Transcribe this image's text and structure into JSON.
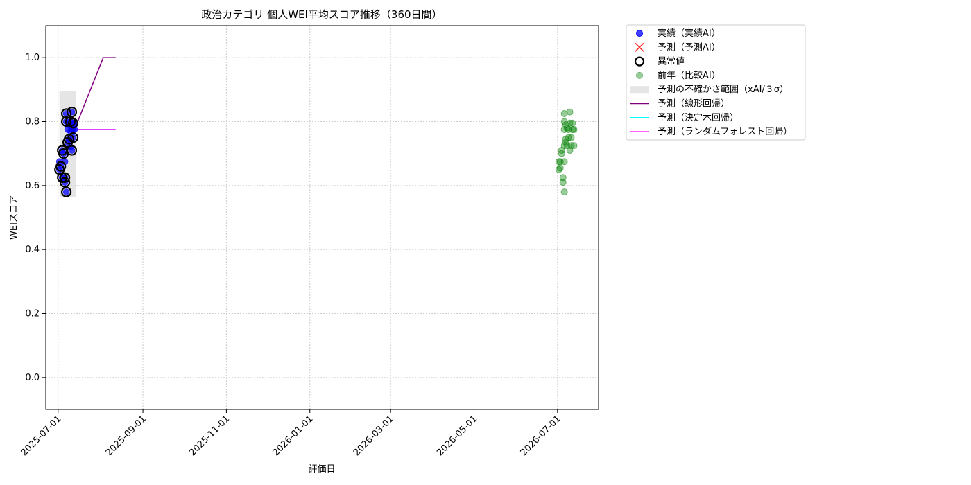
{
  "chart_data": {
    "type": "scatter",
    "title": "政治カテゴリ 個人WEI平均スコア推移（360日間）",
    "xlabel": "評価日",
    "ylabel": "WEIスコア",
    "xlim": [
      "2025-06-22",
      "2026-07-31"
    ],
    "ylim": [
      -0.1,
      1.1
    ],
    "grid": true,
    "legend_position": "outside-top-right",
    "x_ticks": [
      "2025-07-01",
      "2025-09-01",
      "2025-11-01",
      "2026-01-01",
      "2026-03-01",
      "2026-05-01",
      "2026-07-01"
    ],
    "y_ticks": [
      "0.0",
      "0.2",
      "0.4",
      "0.6",
      "0.8",
      "1.0"
    ],
    "colors": {
      "actual": "#0000ff",
      "predicted": "#ff0000",
      "anomaly_edge": "#000000",
      "previous_year": "#008000",
      "uncertainty": "#d3d3d3",
      "linear": "#800080",
      "tree": "#00ffff",
      "forest": "#ff00ff",
      "grid": "#cccccc"
    },
    "series": [
      {
        "name": "実績（実績AI）",
        "kind": "scatter",
        "points": [
          {
            "x": "2025-07-02",
            "y": 0.675
          },
          {
            "x": "2025-07-02",
            "y": 0.65
          },
          {
            "x": "2025-07-03",
            "y": 0.66
          },
          {
            "x": "2025-07-04",
            "y": 0.71
          },
          {
            "x": "2025-07-04",
            "y": 0.625
          },
          {
            "x": "2025-07-05",
            "y": 0.7
          },
          {
            "x": "2025-07-06",
            "y": 0.675
          },
          {
            "x": "2025-07-06",
            "y": 0.61
          },
          {
            "x": "2025-07-06",
            "y": 0.625
          },
          {
            "x": "2025-07-07",
            "y": 0.58
          },
          {
            "x": "2025-07-07",
            "y": 0.8
          },
          {
            "x": "2025-07-07",
            "y": 0.825
          },
          {
            "x": "2025-07-08",
            "y": 0.775
          },
          {
            "x": "2025-07-08",
            "y": 0.735
          },
          {
            "x": "2025-07-09",
            "y": 0.745
          },
          {
            "x": "2025-07-09",
            "y": 0.79
          },
          {
            "x": "2025-07-10",
            "y": 0.8
          },
          {
            "x": "2025-07-10",
            "y": 0.77
          },
          {
            "x": "2025-07-10",
            "y": 0.72
          },
          {
            "x": "2025-07-11",
            "y": 0.83
          },
          {
            "x": "2025-07-11",
            "y": 0.78
          },
          {
            "x": "2025-07-11",
            "y": 0.71
          },
          {
            "x": "2025-07-12",
            "y": 0.795
          },
          {
            "x": "2025-07-12",
            "y": 0.75
          },
          {
            "x": "2025-07-12",
            "y": 0.775
          },
          {
            "x": "2025-07-13",
            "y": 0.775
          },
          {
            "x": "2025-07-13",
            "y": 0.795
          }
        ]
      },
      {
        "name": "予測（予測AI）",
        "kind": "scatter-x",
        "points": []
      },
      {
        "name": "異常値",
        "kind": "scatter-ring",
        "points": [
          {
            "x": "2025-07-02",
            "y": 0.65
          },
          {
            "x": "2025-07-03",
            "y": 0.66
          },
          {
            "x": "2025-07-04",
            "y": 0.71
          },
          {
            "x": "2025-07-04",
            "y": 0.625
          },
          {
            "x": "2025-07-05",
            "y": 0.7
          },
          {
            "x": "2025-07-06",
            "y": 0.61
          },
          {
            "x": "2025-07-06",
            "y": 0.625
          },
          {
            "x": "2025-07-07",
            "y": 0.58
          },
          {
            "x": "2025-07-07",
            "y": 0.8
          },
          {
            "x": "2025-07-07",
            "y": 0.825
          },
          {
            "x": "2025-07-08",
            "y": 0.735
          },
          {
            "x": "2025-07-09",
            "y": 0.745
          },
          {
            "x": "2025-07-10",
            "y": 0.8
          },
          {
            "x": "2025-07-11",
            "y": 0.83
          },
          {
            "x": "2025-07-11",
            "y": 0.71
          },
          {
            "x": "2025-07-12",
            "y": 0.795
          },
          {
            "x": "2025-07-12",
            "y": 0.75
          }
        ]
      },
      {
        "name": "前年（比較AI）",
        "kind": "scatter",
        "points": [
          {
            "x": "2026-07-02",
            "y": 0.675
          },
          {
            "x": "2026-07-02",
            "y": 0.65
          },
          {
            "x": "2026-07-03",
            "y": 0.675
          },
          {
            "x": "2026-07-03",
            "y": 0.655
          },
          {
            "x": "2026-07-04",
            "y": 0.71
          },
          {
            "x": "2026-07-04",
            "y": 0.7
          },
          {
            "x": "2026-07-05",
            "y": 0.625
          },
          {
            "x": "2026-07-05",
            "y": 0.61
          },
          {
            "x": "2026-07-06",
            "y": 0.58
          },
          {
            "x": "2026-07-06",
            "y": 0.675
          },
          {
            "x": "2026-07-06",
            "y": 0.725
          },
          {
            "x": "2026-07-06",
            "y": 0.775
          },
          {
            "x": "2026-07-06",
            "y": 0.8
          },
          {
            "x": "2026-07-06",
            "y": 0.825
          },
          {
            "x": "2026-07-07",
            "y": 0.735
          },
          {
            "x": "2026-07-07",
            "y": 0.745
          },
          {
            "x": "2026-07-07",
            "y": 0.79
          },
          {
            "x": "2026-07-08",
            "y": 0.725
          },
          {
            "x": "2026-07-08",
            "y": 0.78
          },
          {
            "x": "2026-07-09",
            "y": 0.75
          },
          {
            "x": "2026-07-09",
            "y": 0.775
          },
          {
            "x": "2026-07-10",
            "y": 0.71
          },
          {
            "x": "2026-07-10",
            "y": 0.795
          },
          {
            "x": "2026-07-10",
            "y": 0.83
          },
          {
            "x": "2026-07-11",
            "y": 0.75
          },
          {
            "x": "2026-07-11",
            "y": 0.725
          },
          {
            "x": "2026-07-12",
            "y": 0.775
          },
          {
            "x": "2026-07-12",
            "y": 0.795
          },
          {
            "x": "2026-07-13",
            "y": 0.725
          },
          {
            "x": "2026-07-13",
            "y": 0.775
          }
        ]
      },
      {
        "name": "予測の不確かさ範囲（xAI/３σ）",
        "kind": "band",
        "x0": "2025-07-02",
        "x1": "2025-07-14",
        "y0": 0.565,
        "y1": 0.895
      },
      {
        "name": "予測（線形回帰）",
        "kind": "line",
        "points": [
          {
            "x": "2025-07-13",
            "y": 0.775
          },
          {
            "x": "2025-08-03",
            "y": 1.0
          },
          {
            "x": "2025-08-12",
            "y": 1.0
          }
        ]
      },
      {
        "name": "予測（決定木回帰）",
        "kind": "line",
        "points": [
          {
            "x": "2025-07-13",
            "y": 0.775
          },
          {
            "x": "2025-08-12",
            "y": 0.775
          }
        ]
      },
      {
        "name": "予測（ランダムフォレスト回帰）",
        "kind": "line",
        "points": [
          {
            "x": "2025-07-13",
            "y": 0.775
          },
          {
            "x": "2025-08-12",
            "y": 0.775
          }
        ]
      }
    ]
  }
}
